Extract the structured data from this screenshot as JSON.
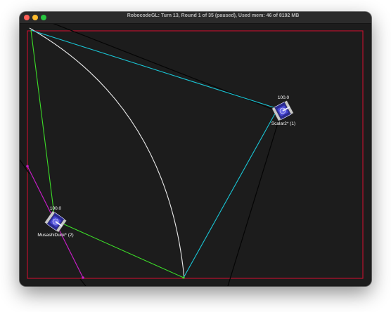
{
  "window": {
    "title": "RobocodeGL: Turn 13, Round 1 of 35 (paused), Used mem: 46 of 8192 MB",
    "traffic_lights": {
      "close_color": "#ff5f57",
      "minimize_color": "#febc2e",
      "maximize_color": "#28c840"
    }
  },
  "battlefield": {
    "background": "#1c1c1c",
    "border_color": "#c8102e",
    "robots": [
      {
        "name": "Scalar2* (1)",
        "energy": "100.0",
        "body_color": "#3a3ab8",
        "scan_color": "#19c6d6"
      },
      {
        "name": "MusashiDuck* (2)",
        "energy": "100.0",
        "body_color": "#3a3ab8",
        "scan_color": "#3cdc28"
      }
    ],
    "colors": {
      "cyan_line": "#19c6d6",
      "green_line": "#3cdc28",
      "magenta_line": "#c21cc2",
      "white_arc": "#e8e8e8",
      "black_line": "#050505"
    }
  }
}
